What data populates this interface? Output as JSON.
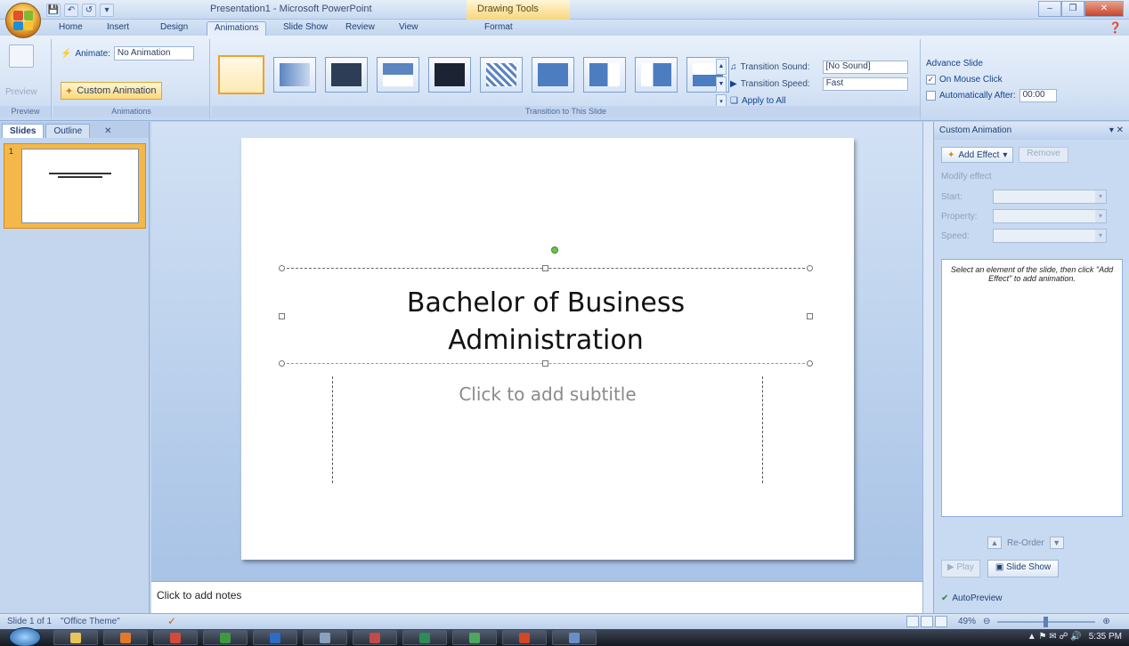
{
  "window": {
    "title": "Presentation1 - Microsoft PowerPoint",
    "contextual_tab_title": "Drawing Tools"
  },
  "tabs": [
    "Home",
    "Insert",
    "Design",
    "Animations",
    "Slide Show",
    "Review",
    "View",
    "Format"
  ],
  "active_tab": "Animations",
  "ribbon": {
    "preview": {
      "label": "Preview",
      "group_label": "Preview"
    },
    "animations": {
      "animate_label": "Animate:",
      "animate_value": "No Animation",
      "custom_animation_label": "Custom Animation",
      "group_label": "Animations"
    },
    "transition": {
      "sound_label": "Transition Sound:",
      "sound_value": "[No Sound]",
      "speed_label": "Transition Speed:",
      "speed_value": "Fast",
      "apply_all_label": "Apply to All",
      "group_label": "Transition to This Slide"
    },
    "advance": {
      "title": "Advance Slide",
      "on_click_label": "On Mouse Click",
      "on_click_checked": true,
      "auto_label": "Automatically After:",
      "auto_checked": false,
      "auto_value": "00:00"
    }
  },
  "left_pane": {
    "tabs": [
      "Slides",
      "Outline"
    ],
    "active_tab": "Slides",
    "slide_number": "1"
  },
  "slide": {
    "title": "Bachelor of Business Administration",
    "subtitle_placeholder": "Click to add subtitle"
  },
  "notes_placeholder": "Click to add notes",
  "task_pane": {
    "title": "Custom Animation",
    "add_effect_label": "Add Effect",
    "remove_label": "Remove",
    "modify_label": "Modify effect",
    "fields": [
      "Start:",
      "Property:",
      "Speed:"
    ],
    "hint": "Select an element of the slide, then click \"Add Effect\" to add animation.",
    "reorder_label": "Re-Order",
    "play_label": "Play",
    "slide_show_label": "Slide Show",
    "autopreview_label": "AutoPreview",
    "autopreview_checked": true
  },
  "status_bar": {
    "slide_info": "Slide 1 of 1",
    "theme": "\"Office Theme\"",
    "zoom": "49%",
    "zoom_level_fraction": 0.49
  },
  "taskbar": {
    "time": "5:35 PM"
  }
}
